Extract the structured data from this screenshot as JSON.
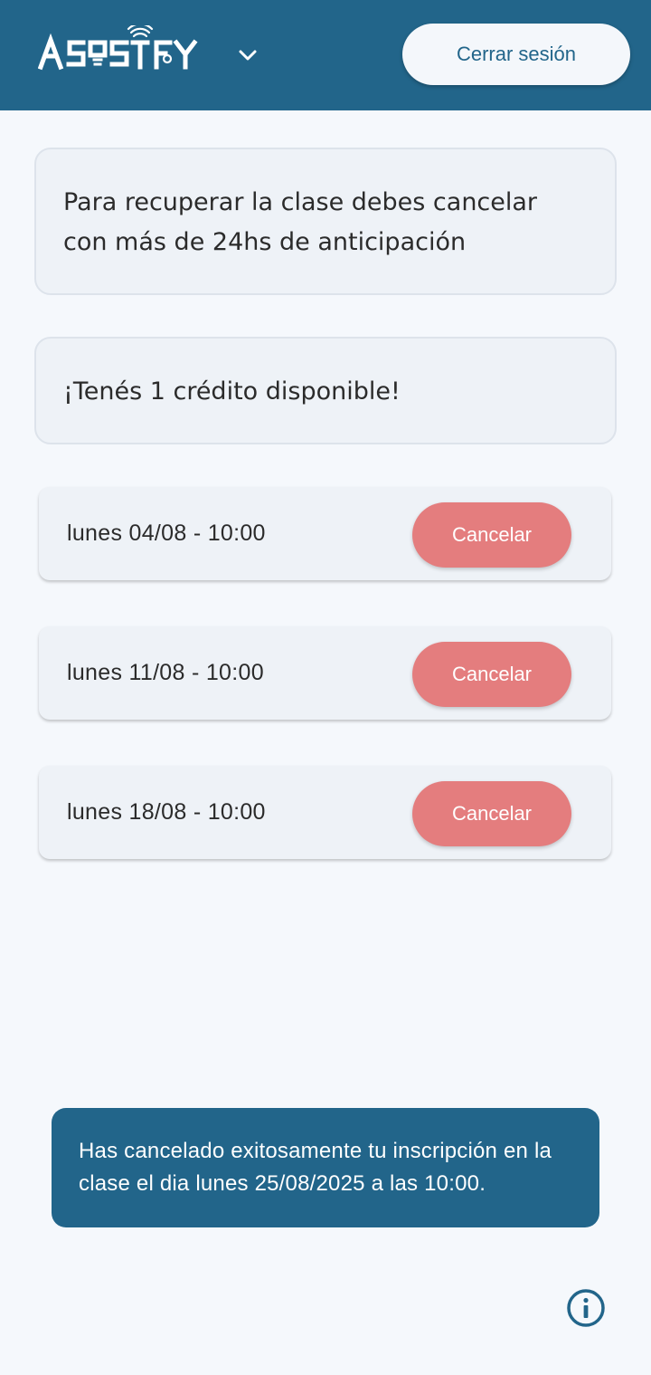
{
  "header": {
    "brand": "ASOSTFY",
    "logout_label": "Cerrar sesión",
    "brand_menu_icon": "chevron-down-icon"
  },
  "notices": {
    "rule_text": "Para recuperar la clase debes cancelar con más de 24hs de anticipación",
    "credit_text": "¡Tenés 1 crédito disponible!"
  },
  "slots": [
    {
      "label": "lunes 04/08 - 10:00",
      "action": "Cancelar"
    },
    {
      "label": "lunes 11/08 - 10:00",
      "action": "Cancelar"
    },
    {
      "label": "lunes 18/08 - 10:00",
      "action": "Cancelar"
    }
  ],
  "toast": {
    "message": "Has cancelado exitosamente tu inscripción en la clase el dia lunes 25/08/2025 a las 10:00."
  },
  "footer": {
    "info_icon": "info-icon"
  },
  "colors": {
    "primary": "#22658a",
    "cancel": "#e47d7e",
    "background": "#f5f8fc",
    "card": "#eef2f7"
  }
}
